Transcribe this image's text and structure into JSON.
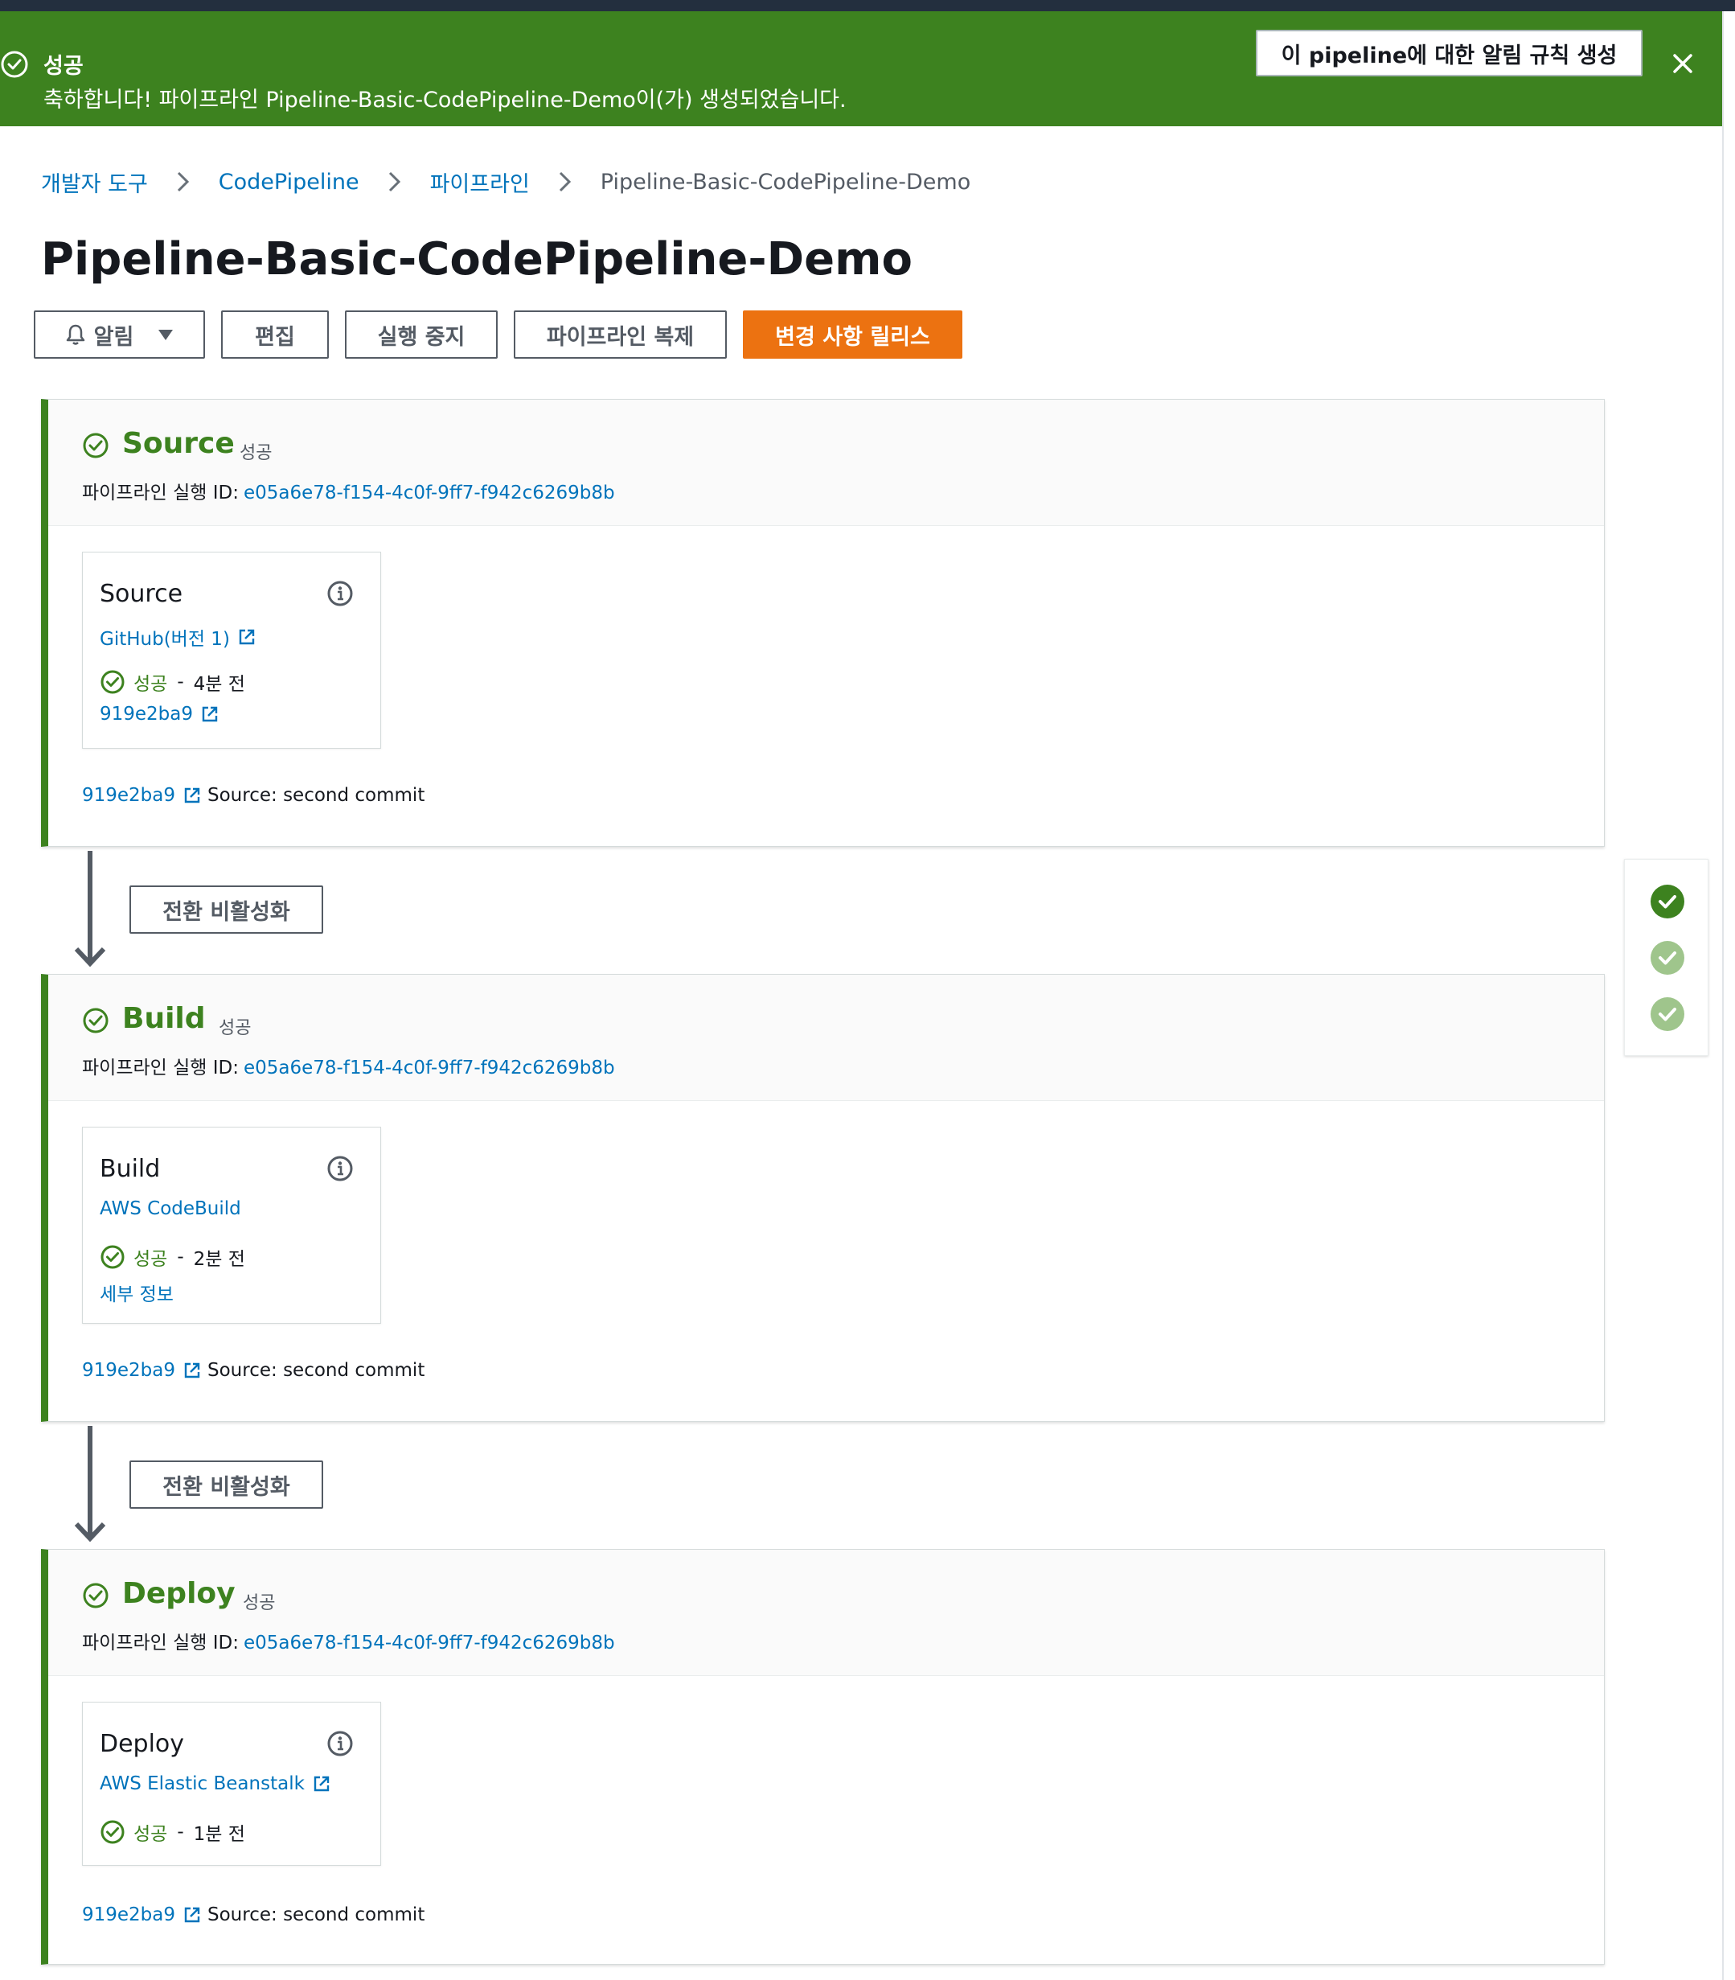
{
  "flash": {
    "title": "성공",
    "message": "축하합니다! 파이프라인 Pipeline-Basic-CodePipeline-Demo이(가) 생성되었습니다.",
    "rule_button": "이 pipeline에 대한 알림 규칙 생성",
    "icons": {
      "status": "check-circle-icon",
      "close": "close-icon"
    },
    "color": "#3d821f"
  },
  "breadcrumb": [
    "개발자 도구",
    "CodePipeline",
    "파이프라인",
    "Pipeline-Basic-CodePipeline-Demo"
  ],
  "page": {
    "title": "Pipeline-Basic-CodePipeline-Demo"
  },
  "actions": {
    "notify": "알림",
    "edit": "편집",
    "stop": "실행 중지",
    "clone": "파이프라인 복제",
    "release": "변경 사항 릴리스",
    "primary_color": "#ec7211"
  },
  "exec_label": "파이프라인 실행 ID:",
  "transition_label": "전환 비활성화",
  "stages": [
    {
      "name": "Source",
      "status": "성공",
      "execution_id": "e05a6e78-f154-4c0f-9ff7-f942c6269b8b",
      "action": {
        "name": "Source",
        "provider": "GitHub(버전 1)",
        "status": "성공",
        "ago": "4분 전",
        "link": "919e2ba9"
      },
      "commit": {
        "hash": "919e2ba9",
        "message": "Source: second commit"
      }
    },
    {
      "name": "Build",
      "status": "성공",
      "execution_id": "e05a6e78-f154-4c0f-9ff7-f942c6269b8b",
      "action": {
        "name": "Build",
        "provider": "AWS CodeBuild",
        "status": "성공",
        "ago": "2분 전",
        "link": "세부 정보"
      },
      "commit": {
        "hash": "919e2ba9",
        "message": "Source: second commit"
      }
    },
    {
      "name": "Deploy",
      "status": "성공",
      "execution_id": "e05a6e78-f154-4c0f-9ff7-f942c6269b8b",
      "action": {
        "name": "Deploy",
        "provider": "AWS Elastic Beanstalk",
        "status": "성공",
        "ago": "1분 전"
      },
      "commit": {
        "hash": "919e2ba9",
        "message": "Source: second commit"
      }
    }
  ],
  "colors": {
    "success": "#3d821f",
    "link": "#0073bb",
    "mini_active": "#3d821f",
    "mini_done": "#9fc58c"
  }
}
